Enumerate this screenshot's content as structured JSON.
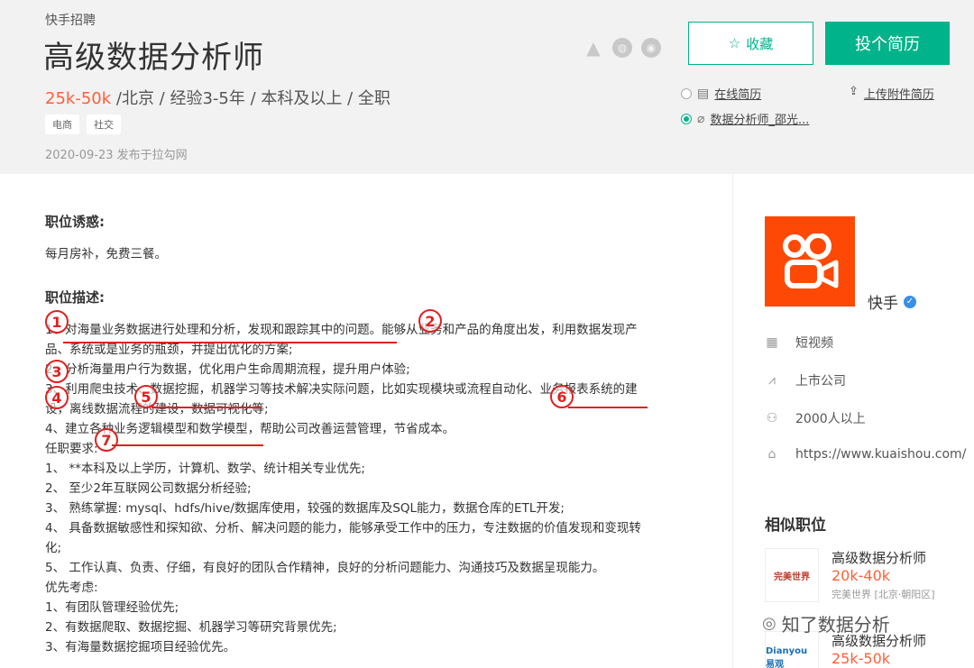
{
  "header": {
    "company_link": "快手招聘",
    "title": "高级数据分析师",
    "salary": "25k-50k",
    "requirements": " /北京 / 经验3-5年 / 本科及以上 / 全职",
    "tags": [
      "电商",
      "社交"
    ],
    "publish": "2020-09-23  发布于拉勾网",
    "favorite_label": "收藏",
    "apply_label": "投个简历",
    "online_resume": "在线简历",
    "attached_resume": "数据分析师_邵光...",
    "upload_label": "上传附件简历",
    "accent": "#00b38a",
    "salary_color": "#fd5f39"
  },
  "content": {
    "perks_title": "职位诱惑:",
    "perks_text": "每月房补，免费三餐。",
    "desc_title": "职位描述:",
    "lines": [
      "1、对海量业务数据进行处理和分析，发现和跟踪其中的问题。能够从业务和产品的角度出发，利用数据发现产",
      "品、系统或是业务的瓶颈，并提出优化的方案;",
      "2、分析海量用户行为数据，优化用户生命周期流程，提升用户体验;",
      "3、利用爬虫技术、数据挖掘，机器学习等技术解决实际问题，比如实现模块或流程自动化、业务报表系统的建",
      "设，离线数据流程的建设，数据可视化等;",
      "4、建立各种业务逻辑模型和数学模型，帮助公司改善运营管理，节省成本。",
      "任职要求:",
      "1、  **本科及以上学历，计算机、数学、统计相关专业优先;",
      "2、  至少2年互联网公司数据分析经验;",
      "3、  熟练掌握: mysql、hdfs/hive/数据库使用，较强的数据库及SQL能力，数据仓库的ETL开发;",
      "4、  具备数据敏感性和探知欲、分析、解决问题的能力，能够承受工作中的压力，专注数据的价值发现和变现转",
      "化;",
      "5、  工作认真、负责、仔细，有良好的团队合作精神，良好的分析问题能力、沟通技巧及数据呈现能力。",
      "优先考虑:",
      "1、有团队管理经验优先;",
      "2、有数据爬取、数据挖掘、机器学习等研究背景优先;",
      "3、有海量数据挖掘项目经验优先。"
    ],
    "annotations": [
      "1",
      "2",
      "3",
      "4",
      "5",
      "6",
      "7"
    ]
  },
  "sidebar": {
    "company": "快手",
    "info": [
      {
        "icon": "grid-icon",
        "text": "短视频"
      },
      {
        "icon": "chart-icon",
        "text": "上市公司"
      },
      {
        "icon": "people-icon",
        "text": "2000人以上"
      },
      {
        "icon": "home-icon",
        "text": "https://www.kuaishou.com/"
      }
    ],
    "similar_title": "相似职位",
    "similar": [
      {
        "title": "高级数据分析师",
        "salary": "20k-40k",
        "company": "完美世界 [北京·朝阳区]",
        "logo_text": "完美世界"
      },
      {
        "title": "高级数据分析师",
        "salary": "25k-50k",
        "company": "",
        "logo_text": "Dianyou 易观"
      }
    ]
  },
  "watermark": "知了数据分析"
}
